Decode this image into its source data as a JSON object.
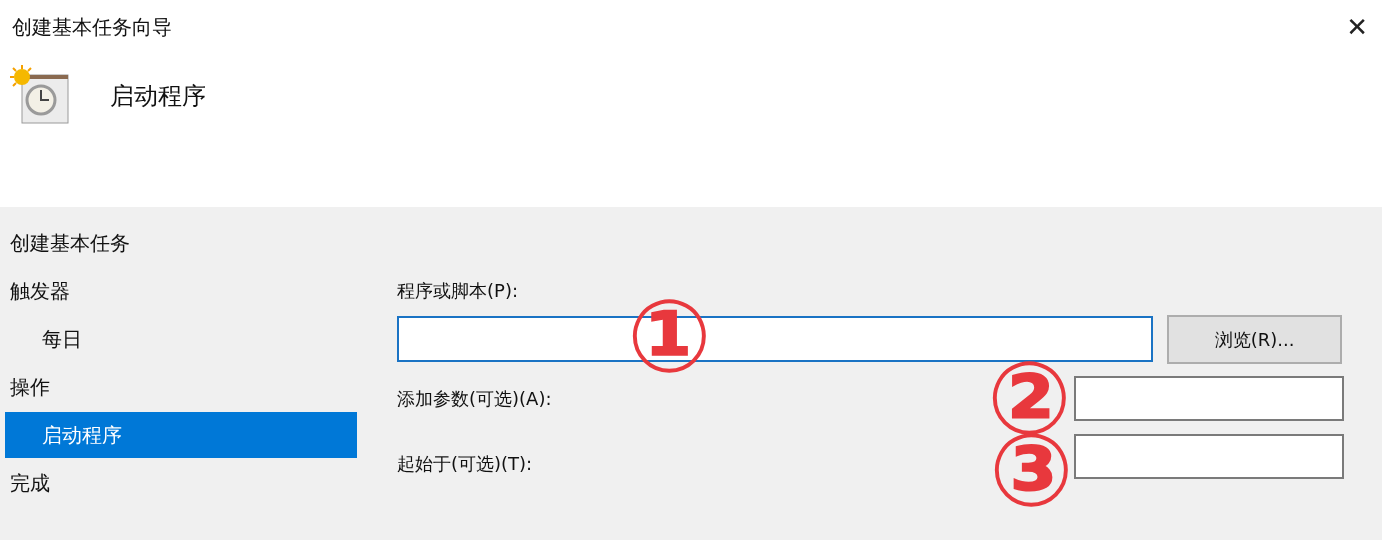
{
  "window": {
    "title": "创建基本任务向导",
    "close": "✕"
  },
  "header": {
    "heading": "启动程序"
  },
  "sidebar": {
    "items": [
      {
        "label": "创建基本任务",
        "selected": false
      },
      {
        "label": "触发器",
        "selected": false,
        "children": [
          {
            "label": "每日",
            "selected": false
          }
        ]
      },
      {
        "label": "操作",
        "selected": false,
        "children": [
          {
            "label": "启动程序",
            "selected": true
          }
        ]
      },
      {
        "label": "完成",
        "selected": false
      }
    ]
  },
  "form": {
    "program": {
      "label": "程序或脚本(P):",
      "annotation": "①"
    },
    "browse_button": "浏览(R)...",
    "arguments": {
      "label": "添加参数(可选)(A):",
      "annotation": "②"
    },
    "start_in": {
      "label": "起始于(可选)(T):",
      "annotation": "③"
    }
  }
}
